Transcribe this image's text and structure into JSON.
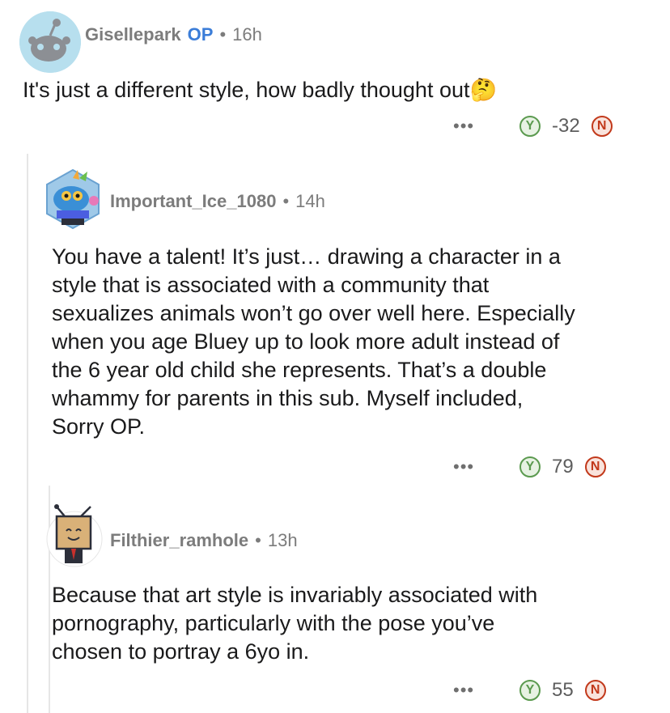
{
  "comments": [
    {
      "username": "Gisellepark",
      "op_badge": "OP",
      "separator": "•",
      "time": "16h",
      "body": "It's just a different style, how badly thought out",
      "emoji": "🤔",
      "score": "-32",
      "more": "•••",
      "upvote": "Y",
      "downvote": "N"
    },
    {
      "username": "Important_Ice_1080",
      "separator": "•",
      "time": "14h",
      "body_lines": [
        "You have a talent! It’s just… drawing a character in a",
        "style that is associated with a community that",
        "sexualizes animals won’t go over well here. Especially",
        "when you age Bluey up to look more adult instead of",
        "the 6 year old child she represents. That’s a double",
        "whammy for parents in this sub. Myself included,",
        "Sorry OP."
      ],
      "score": "79",
      "more": "•••",
      "upvote": "Y",
      "downvote": "N"
    },
    {
      "username": "Filthier_ramhole",
      "separator": "•",
      "time": "13h",
      "body_lines": [
        "Because that art style is invariably associated with",
        "pornography, particularly with the pose you’ve",
        "chosen to portray a 6yo in."
      ],
      "score": "55",
      "more": "•••",
      "upvote": "Y",
      "downvote": "N"
    }
  ],
  "icons": {
    "avatar_1": "default-snoo-avatar-icon",
    "avatar_2": "nft-avatar-icon",
    "avatar_3": "tv-head-avatar-icon",
    "upvote": "upvote-icon",
    "downvote": "downvote-icon",
    "more": "more-options-icon"
  },
  "colors": {
    "op": "#3b7dd8",
    "upvote": "#5b9a4f",
    "downvote": "#c2391b",
    "meta": "#7c7c7c"
  }
}
